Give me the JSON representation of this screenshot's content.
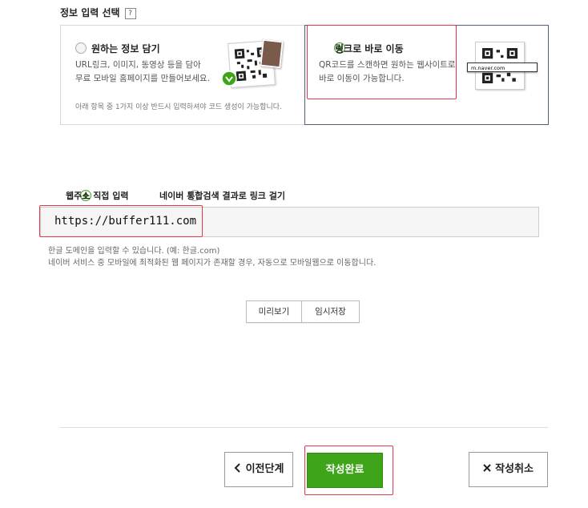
{
  "section": {
    "title": "정보 입력 선택",
    "help": "?"
  },
  "options": {
    "left": {
      "title": "원하는 정보 담기",
      "desc1": "URL링크, 이미지, 동영상 등을 담아",
      "desc2": "무료 모바일 홈페이지를 만들어보세요.",
      "note": "아래 항목 중 1가지 이상 반드시 입력하셔야 코드 생성이 가능합니다.",
      "selected": false
    },
    "right": {
      "title": "링크로 바로 이동",
      "desc1": "QR코드를 스캔하면 원하는 웹사이트로",
      "desc2": "바로 이동이 가능합니다.",
      "url_thumb": "m.naver.com",
      "selected": true
    }
  },
  "link_mode": {
    "direct": "웹주소 직접 입력",
    "search": "네이버 통합검색 결과로 링크 걸기",
    "selected": "direct"
  },
  "url_input": {
    "value": "https://buffer111.com"
  },
  "hints": {
    "line1": "한글 도메인을 입력할 수 있습니다. (예: 한글.com)",
    "line2": "네이버 서비스 중 모바일에 최적화된 웹 페이지가 존재할 경우, 자동으로 모바일웹으로 이동합니다."
  },
  "actions": {
    "preview": "미리보기",
    "save_draft": "임시저장",
    "prev": "이전단계",
    "prev_icon": "chevron-left",
    "complete": "작성완료",
    "cancel": "작성취소",
    "cancel_icon": "x"
  },
  "colors": {
    "accent_green": "#3ea51a",
    "highlight_red": "#e0394b",
    "selected_border": "#506079"
  }
}
